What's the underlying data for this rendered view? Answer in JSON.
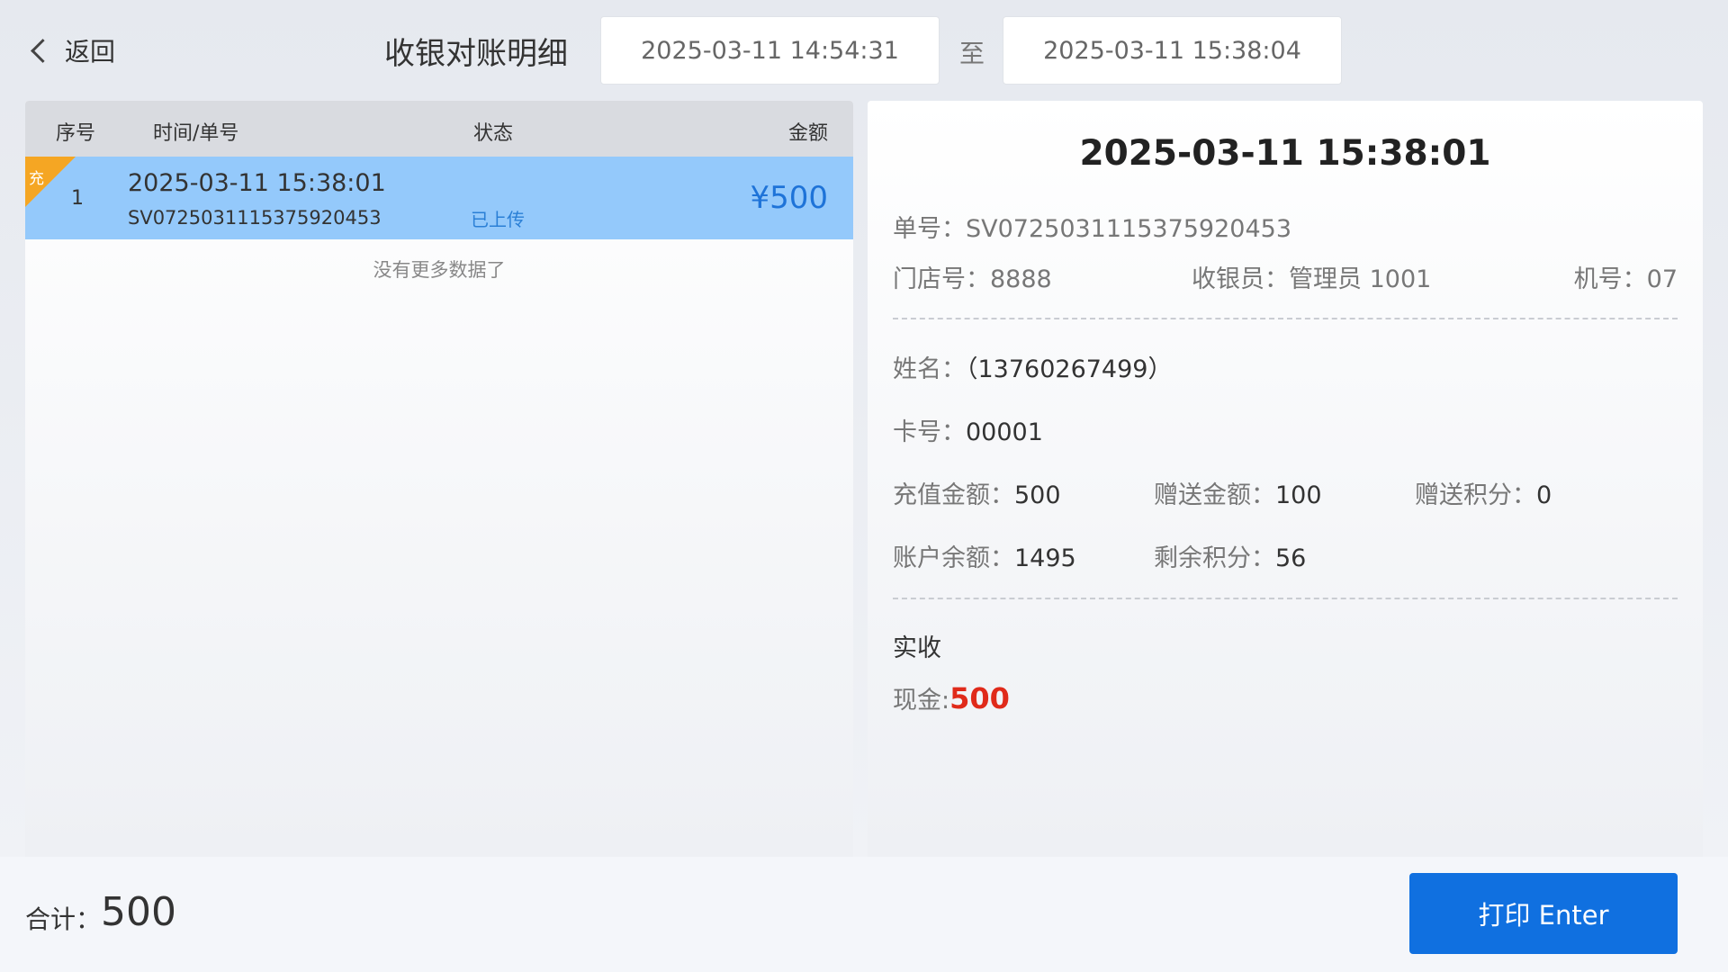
{
  "header": {
    "back_label": "返回",
    "title": "收银对账明细",
    "start_date": "2025-03-11 14:54:31",
    "to_label": "至",
    "end_date": "2025-03-11 15:38:04"
  },
  "table": {
    "columns": {
      "no": "序号",
      "time": "时间/单号",
      "status": "状态",
      "amount": "金额"
    },
    "rows": [
      {
        "tag": "充",
        "no": "1",
        "time": "2025-03-11 15:38:01",
        "order_no": "SV0725031115375920453",
        "status": "已上传",
        "amount": "¥500"
      }
    ],
    "no_more": "没有更多数据了"
  },
  "detail": {
    "time": "2025-03-11 15:38:01",
    "order_label": "单号：",
    "order_value": "SV0725031115375920453",
    "store_label": "门店号：",
    "store_value": "8888",
    "cashier_label": "收银员：",
    "cashier_value": "管理员 1001",
    "machine_label": "机号：",
    "machine_value": "07",
    "name_label": "姓名：",
    "name_value": "（13760267499）",
    "card_label": "卡号：",
    "card_value": "00001",
    "recharge_label": "充值金额：",
    "recharge_value": "500",
    "bonus_amount_label": "赠送金额：",
    "bonus_amount_value": "100",
    "bonus_points_label": "赠送积分：",
    "bonus_points_value": "0",
    "balance_label": "账户余额：",
    "balance_value": "1495",
    "remaining_points_label": "剩余积分：",
    "remaining_points_value": "56",
    "received_title": "实收",
    "cash_label": "现金:",
    "cash_value": "500"
  },
  "footer": {
    "total_label": "合计：",
    "total_value": "500",
    "print_label": "打印 Enter"
  },
  "colors": {
    "selected_row": "#94c9fb",
    "accent_blue": "#1070e0",
    "cash_red": "#e02a1a",
    "ribbon_orange": "#f5a623"
  }
}
